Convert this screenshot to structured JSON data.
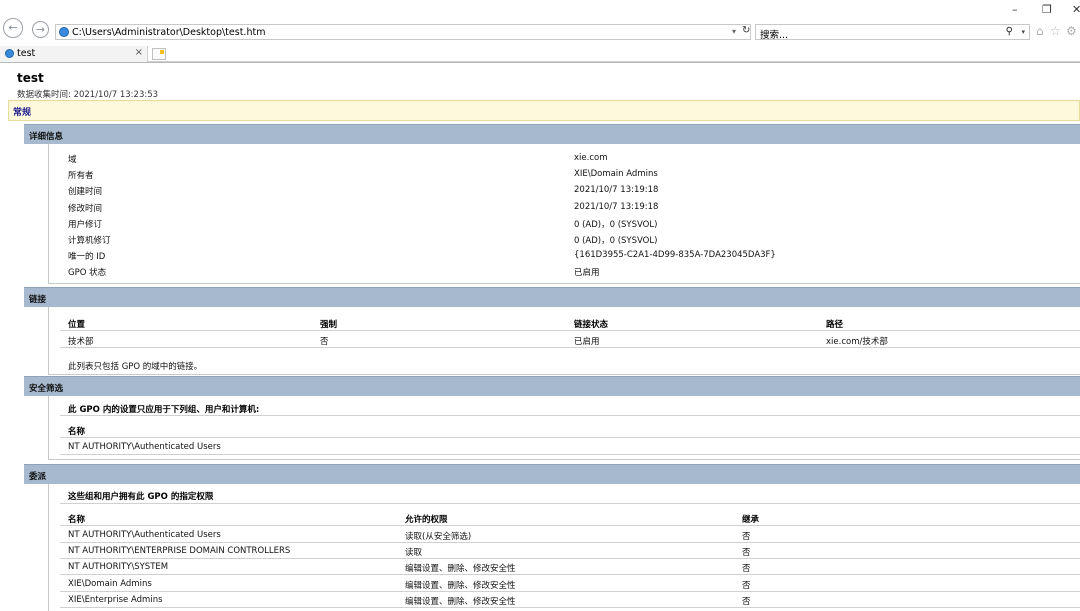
{
  "browser": {
    "url": "C:\\Users\\Administrator\\Desktop\\test.htm",
    "search_placeholder": "搜索...",
    "tab_title": "test",
    "tab_close": "×",
    "window_controls": {
      "minimize": "–",
      "restore": "❐",
      "close": "✕"
    }
  },
  "report": {
    "title": "test",
    "collected_at": "数据收集时间: 2021/10/7 13:23:53",
    "general_label": "常规",
    "details": {
      "heading": "详细信息",
      "rows": [
        {
          "k": "域",
          "v": "xie.com"
        },
        {
          "k": "所有者",
          "v": "XIE\\Domain Admins"
        },
        {
          "k": "创建时间",
          "v": "2021/10/7 13:19:18"
        },
        {
          "k": "修改时间",
          "v": "2021/10/7 13:19:18"
        },
        {
          "k": "用户修订",
          "v": "0 (AD)，0 (SYSVOL)"
        },
        {
          "k": "计算机修订",
          "v": "0 (AD)，0 (SYSVOL)"
        },
        {
          "k": "唯一的 ID",
          "v": "{161D3955-C2A1-4D99-835A-7DA23045DA3F}"
        },
        {
          "k": "GPO 状态",
          "v": "已启用"
        }
      ]
    },
    "links": {
      "heading": "链接",
      "columns": [
        "位置",
        "强制",
        "链接状态",
        "路径"
      ],
      "rows": [
        [
          "技术部",
          "否",
          "已启用",
          "xie.com/技术部"
        ]
      ],
      "note": "此列表只包括 GPO 的域中的链接。"
    },
    "security": {
      "heading": "安全筛选",
      "subtitle": "此 GPO 内的设置只应用于下列组、用户和计算机:",
      "column": "名称",
      "rows": [
        "NT AUTHORITY\\Authenticated Users"
      ]
    },
    "delegation": {
      "heading": "委派",
      "subtitle": "这些组和用户拥有此 GPO 的指定权限",
      "columns": [
        "名称",
        "允许的权限",
        "继承"
      ],
      "rows": [
        [
          "NT AUTHORITY\\Authenticated Users",
          "读取(从安全筛选)",
          "否"
        ],
        [
          "NT AUTHORITY\\ENTERPRISE DOMAIN CONTROLLERS",
          "读取",
          "否"
        ],
        [
          "NT AUTHORITY\\SYSTEM",
          "编辑设置、删除、修改安全性",
          "否"
        ],
        [
          "XIE\\Domain Admins",
          "编辑设置、删除、修改安全性",
          "否"
        ],
        [
          "XIE\\Enterprise Admins",
          "编辑设置、删除、修改安全性",
          "否"
        ]
      ]
    }
  }
}
